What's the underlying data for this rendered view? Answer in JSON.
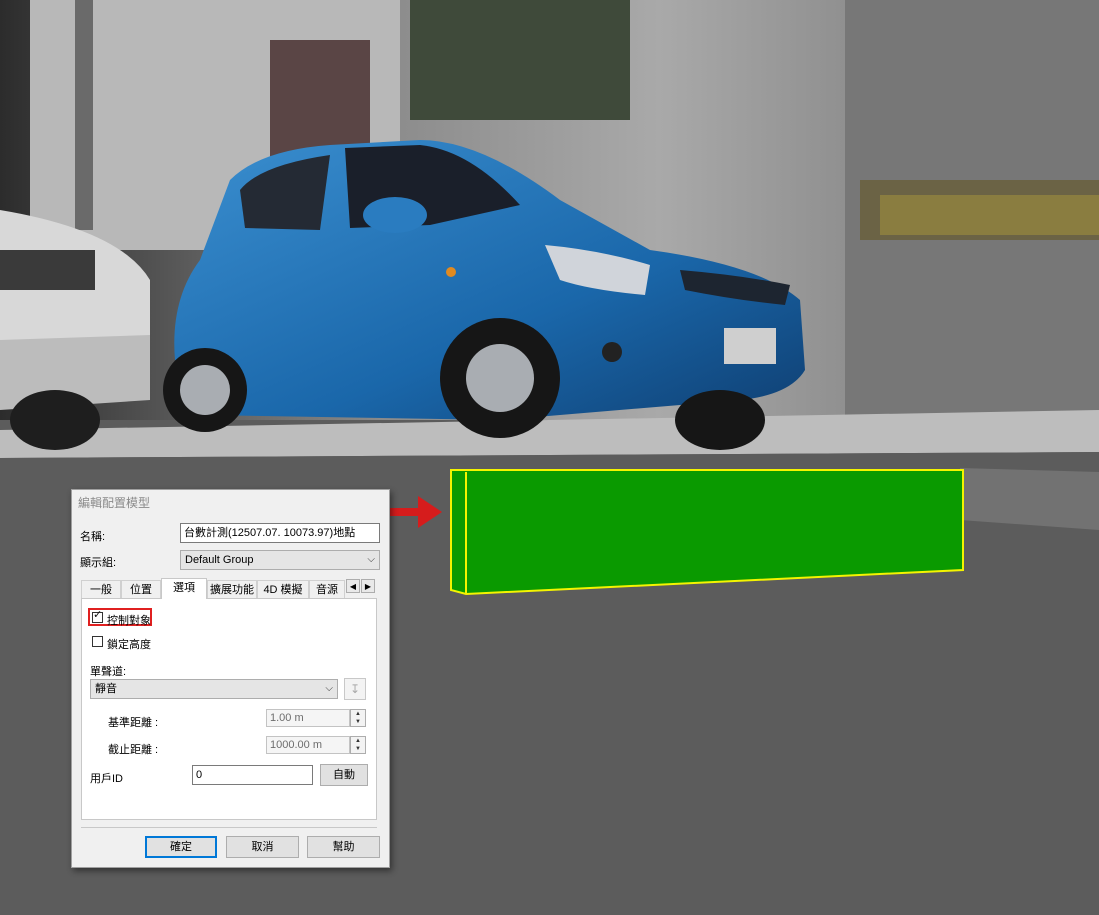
{
  "dialog": {
    "title": "編輯配置模型",
    "name_label": "名稱:",
    "name_value": "台數計測(12507.07. 10073.97)地點",
    "group_label": "顯示組:",
    "group_value": "Default Group",
    "tabs": [
      {
        "label": "一般"
      },
      {
        "label": "位置"
      },
      {
        "label": "選項"
      },
      {
        "label": "擴展功能"
      },
      {
        "label": "4D 模擬"
      },
      {
        "label": "音源"
      }
    ],
    "active_tab": "選項",
    "control_object_label": "控制對象",
    "control_object_checked": true,
    "lock_height_label": "鎖定高度",
    "lock_height_checked": false,
    "sound_channel_label": "單聲道:",
    "sound_channel_value": "靜音",
    "ref_distance_label": "基準距離 :",
    "ref_distance_value": "1.00 m",
    "cutoff_distance_label": "截止距離 :",
    "cutoff_distance_value": "1000.00 m",
    "user_id_label": "用戶ID",
    "user_id_value": "0",
    "auto_button": "自動",
    "ok_button": "確定",
    "cancel_button": "取消",
    "help_button": "幫助"
  },
  "colors": {
    "car_body": "#1f6fb5",
    "sensor_box": "#0a9a00",
    "sensor_outline": "#f4f400",
    "highlight": "#e02020",
    "accent": "#0078d7"
  }
}
